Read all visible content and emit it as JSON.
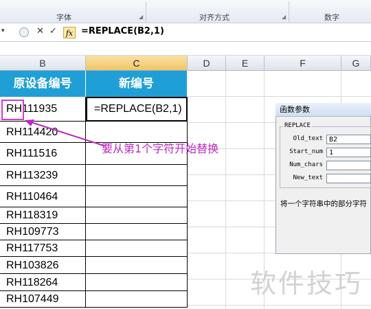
{
  "ribbon": {
    "groups": [
      {
        "label": "字体"
      },
      {
        "label": "对齐方式"
      },
      {
        "label": "数字"
      }
    ]
  },
  "formula_bar": {
    "icons": {
      "cancel": "✕",
      "enter": "✓",
      "fx": "fx"
    },
    "formula": "=REPLACE(B2,1)"
  },
  "columns": [
    "B",
    "C",
    "D",
    "E",
    "F",
    "G"
  ],
  "table": {
    "header_b": "原设备编号",
    "header_c": "新编号",
    "c2_value": "=REPLACE(B2,1)",
    "b_values": [
      "RH111935",
      "RH114420",
      "RH111516",
      "RH113239",
      "RH110464",
      "RH118319",
      "RH109773",
      "RH117753",
      "RH103826",
      "RH118264",
      "RH107449"
    ]
  },
  "annotation": "要从第1个字符开始替换",
  "dialog": {
    "title": "函数参数",
    "function_name": "REPLACE",
    "fields": [
      {
        "label": "Old_text",
        "value": "B2"
      },
      {
        "label": "Start_num",
        "value": "1"
      },
      {
        "label": "Num_chars",
        "value": ""
      },
      {
        "label": "New_text",
        "value": ""
      }
    ],
    "description": "将一个字符串中的部分字符"
  },
  "watermark": "软件技巧",
  "colors": {
    "header_blue": "#1f9fd6",
    "annotation_purple": "#c026c0",
    "selected_col": "#f1c665"
  }
}
